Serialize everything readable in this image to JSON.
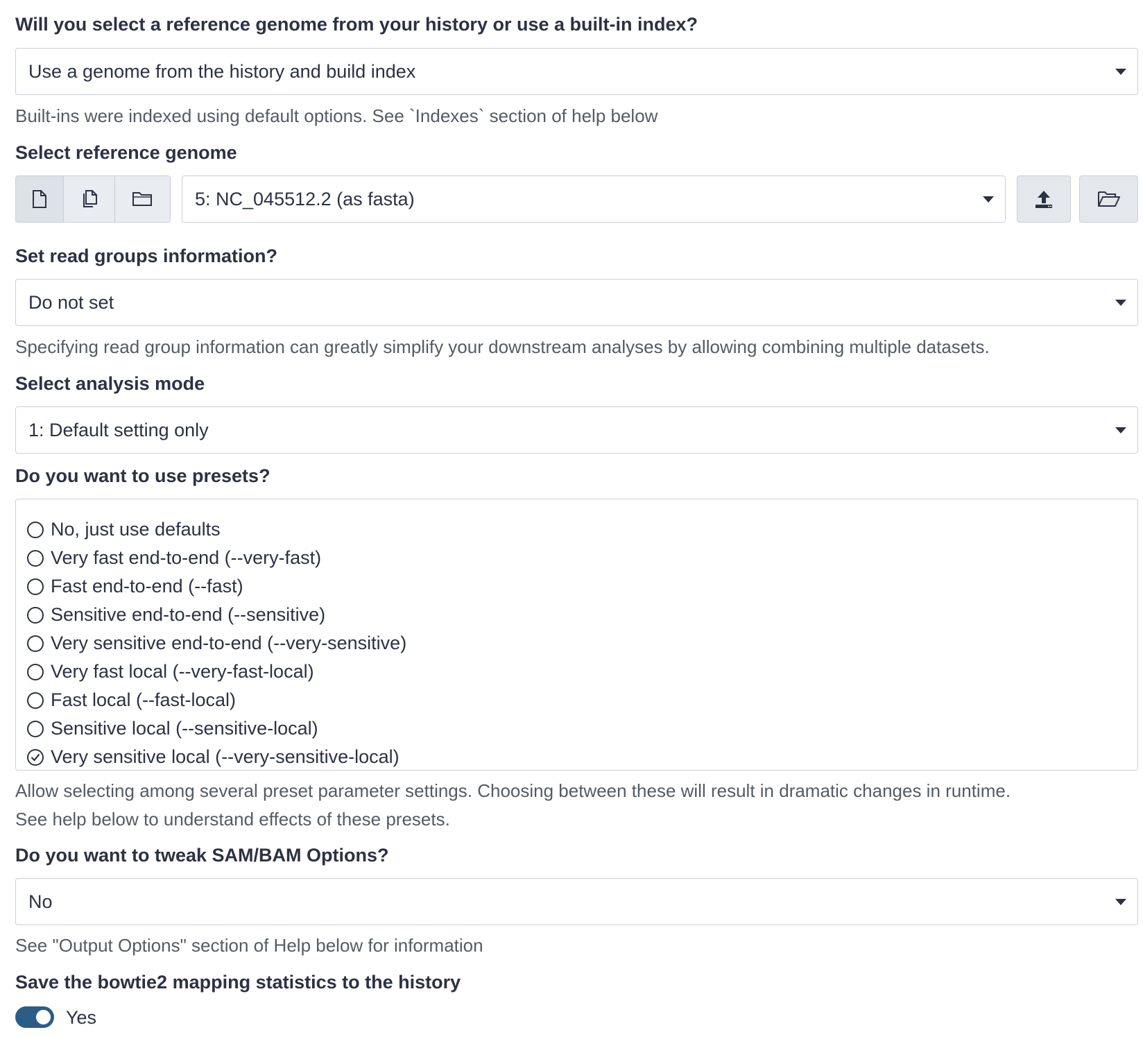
{
  "genome_source": {
    "label": "Will you select a reference genome from your history or use a built-in index?",
    "value": "Use a genome from the history and build index",
    "help": "Built-ins were indexed using default options. See `Indexes` section of help below"
  },
  "reference_genome": {
    "label": "Select reference genome",
    "value": "5: NC_045512.2 (as fasta)",
    "mode_icons": [
      "single-dataset-icon",
      "multiple-datasets-icon",
      "dataset-collection-icon"
    ],
    "action_icons": [
      "upload-icon",
      "browse-folder-icon"
    ]
  },
  "read_groups": {
    "label": "Set read groups information?",
    "value": "Do not set",
    "help": "Specifying read group information can greatly simplify your downstream analyses by allowing combining multiple datasets."
  },
  "analysis_mode": {
    "label": "Select analysis mode",
    "value": "1: Default setting only"
  },
  "presets": {
    "label": "Do you want to use presets?",
    "options": [
      "No, just use defaults",
      "Very fast end-to-end (--very-fast)",
      "Fast end-to-end (--fast)",
      "Sensitive end-to-end (--sensitive)",
      "Very sensitive end-to-end (--very-sensitive)",
      "Very fast local (--very-fast-local)",
      "Fast local (--fast-local)",
      "Sensitive local (--sensitive-local)",
      "Very sensitive local (--very-sensitive-local)"
    ],
    "selected_index": 8,
    "help_line1": "Allow selecting among several preset parameter settings. Choosing between these will result in dramatic changes in runtime.",
    "help_line2": "See help below to understand effects of these presets."
  },
  "sam_options": {
    "label": "Do you want to tweak SAM/BAM Options?",
    "value": "No",
    "help": "See \"Output Options\" section of Help below for information"
  },
  "save_stats": {
    "label": "Save the bowtie2 mapping statistics to the history",
    "value": "Yes",
    "checked": true
  },
  "colors": {
    "text": "#2c3143",
    "help_text": "#545b64",
    "border": "#c9cfd8",
    "toggle_on": "#2c5d86"
  }
}
